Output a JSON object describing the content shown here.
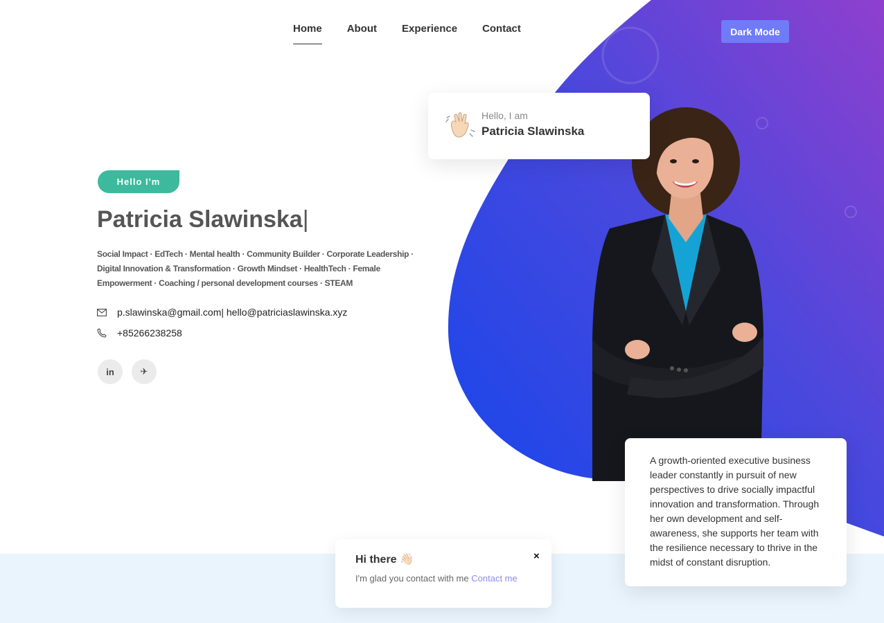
{
  "nav": {
    "items": [
      {
        "label": "Home",
        "active": true
      },
      {
        "label": "About",
        "active": false
      },
      {
        "label": "Experience",
        "active": false
      },
      {
        "label": "Contact",
        "active": false
      }
    ],
    "dark_mode_label": "Dark Mode"
  },
  "hero": {
    "badge": "Hello I'm",
    "name": "Patricia Slawinska",
    "cursor": "|",
    "tags": "Social Impact · EdTech · Mental health · Community Builder · Corporate Leadership · Digital Innovation & Transformation · Growth Mindset · HealthTech · Female Empowerment · Coaching / personal development courses · STEAM",
    "email": "p.slawinska@gmail.com| hello@patriciaslawinska.xyz",
    "phone": "+85266238258",
    "socials": [
      {
        "label": "in",
        "icon": "linkedin-icon"
      },
      {
        "label": "✈",
        "icon": "telegram-icon"
      }
    ]
  },
  "hello_card": {
    "intro": "Hello, I am",
    "name": "Patricia Slawinska",
    "icon": "waving-hand-icon"
  },
  "bio": "A growth-oriented executive business leader constantly in pursuit of new perspectives to drive socially impactful innovation and transformation. Through her own development and self-awareness, she supports her team with the resilience necessary to thrive in the midst of constant disruption.",
  "chat": {
    "title": "Hi there 👋🏻",
    "message": "I'm glad you contact with me",
    "link": "Contact me",
    "close": "×"
  },
  "colors": {
    "accent": "#6f7bf7",
    "badge": "#3dba9d",
    "blob_blue": "#1e4fe6",
    "blob_purple": "#8a3fd0"
  }
}
